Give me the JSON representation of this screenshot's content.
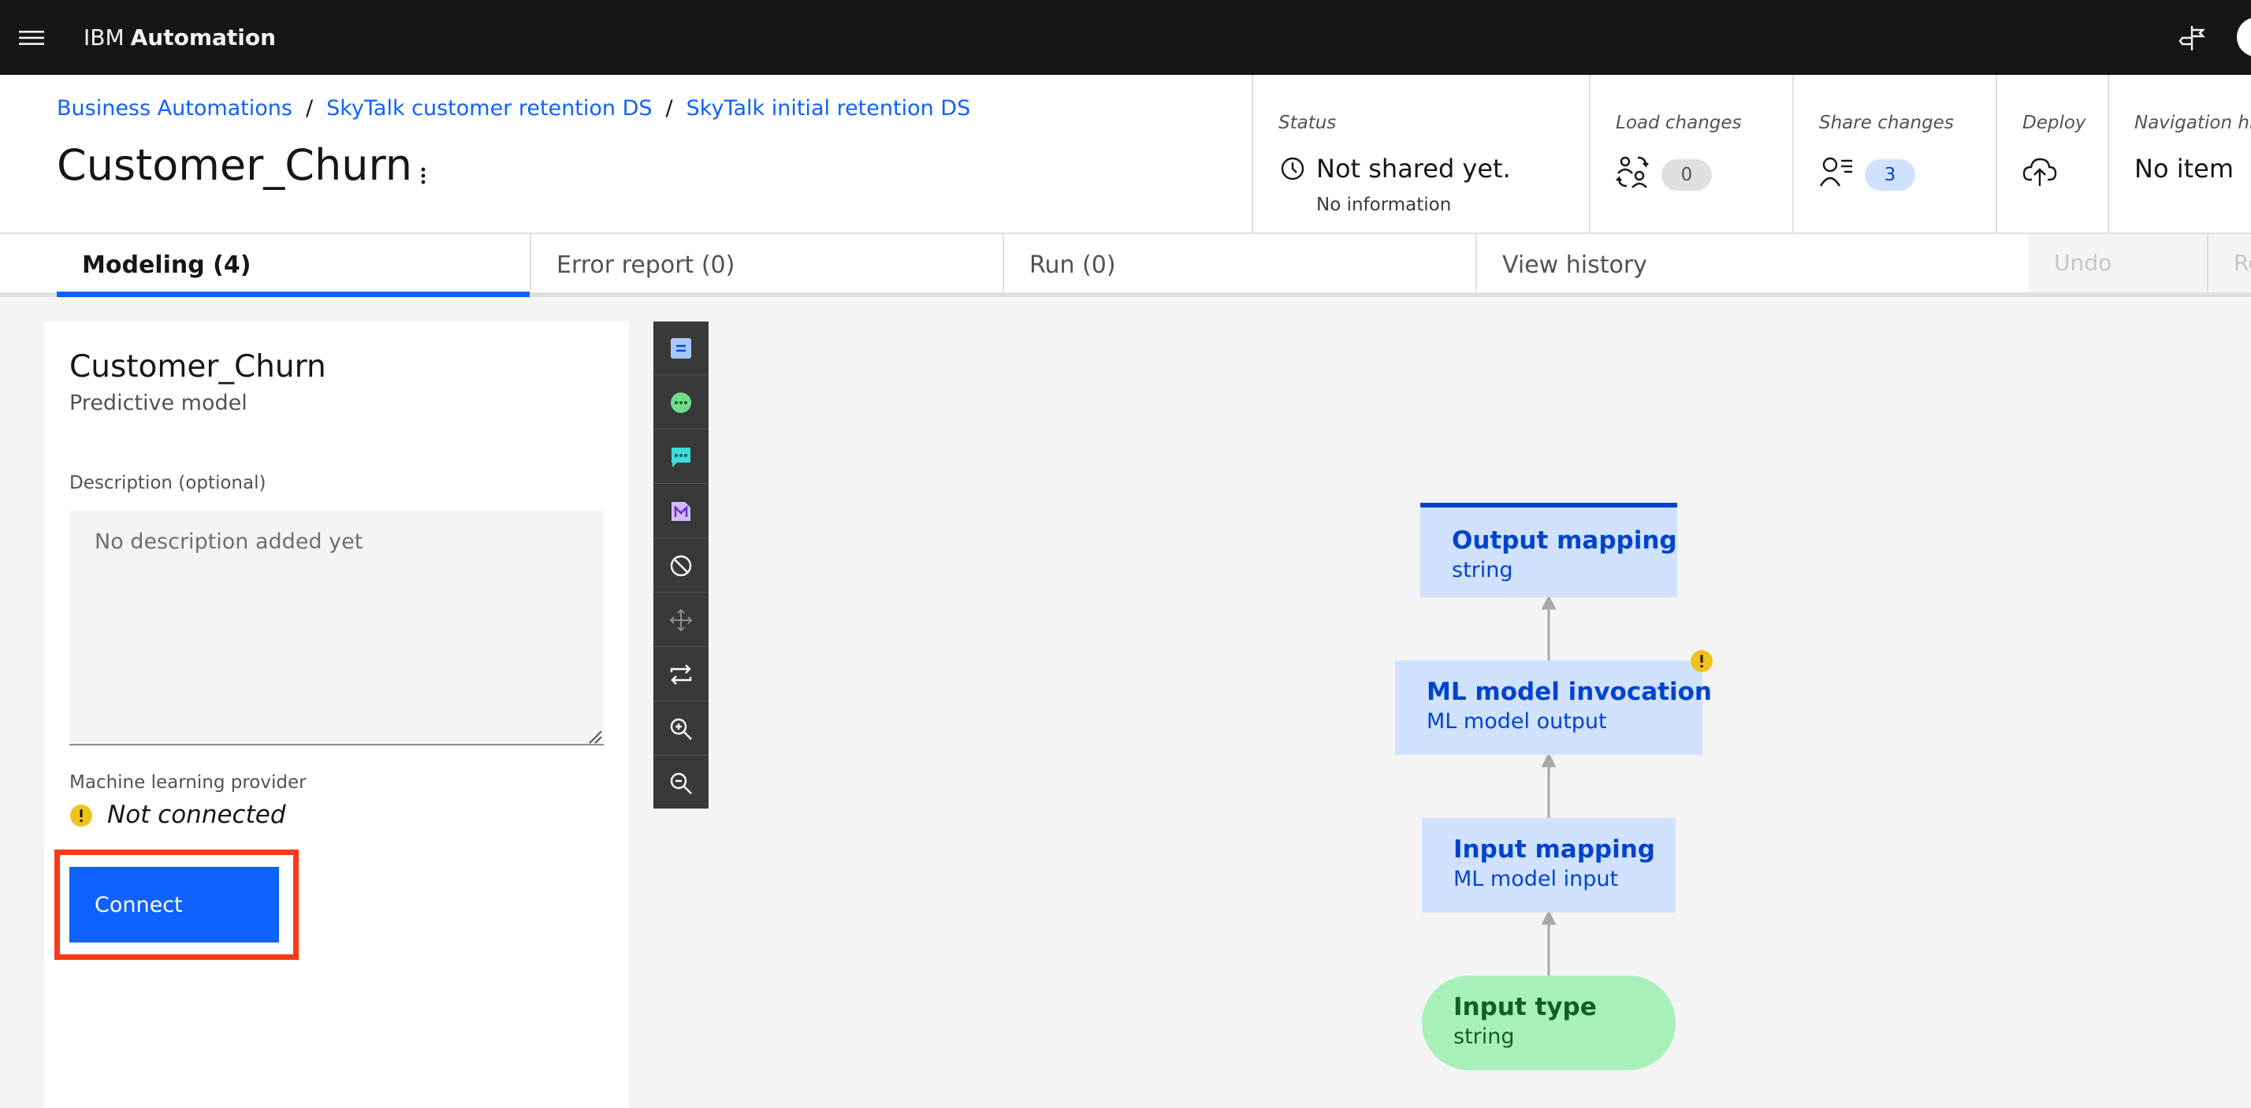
{
  "topbar": {
    "brand_prefix": "IBM",
    "brand_name": "Automation",
    "icons": [
      "menu-icon",
      "guide-icon"
    ]
  },
  "header": {
    "breadcrumb": [
      "Business Automations",
      "SkyTalk customer retention DS",
      "SkyTalk initial retention DS"
    ],
    "breadcrumb_separator": "/",
    "title": "Customer_Churn",
    "status": {
      "label": "Status",
      "value": "Not shared yet.",
      "sub": "No information"
    },
    "load_changes": {
      "label": "Load changes",
      "count": "0"
    },
    "share_changes": {
      "label": "Share changes",
      "count": "3"
    },
    "deploy": {
      "label": "Deploy"
    },
    "navigation_history": {
      "label": "Navigation hi",
      "value": "No item"
    }
  },
  "tabs": [
    {
      "label": "Modeling (4)",
      "active": true
    },
    {
      "label": "Error report (0)",
      "active": false
    },
    {
      "label": "Run (0)",
      "active": false
    },
    {
      "label": "View history",
      "active": false
    }
  ],
  "toolbar": {
    "undo_label": "Undo",
    "redo_label": "Re"
  },
  "panel": {
    "title": "Customer_Churn",
    "subtitle": "Predictive model",
    "description_label": "Description (optional)",
    "description_placeholder": "No description added yet",
    "description_value": "",
    "ml_provider_label": "Machine learning provider",
    "ml_provider_status": "Not connected",
    "connect_label": "Connect"
  },
  "vertical_toolbar": {
    "items": [
      "decision-node-icon",
      "function-node-icon",
      "comment-icon",
      "model-node-icon",
      "prohibit-icon",
      "move-icon",
      "swap-icon",
      "zoom-in-icon",
      "zoom-out-icon"
    ]
  },
  "diagram": {
    "nodes": [
      {
        "title": "Output mapping",
        "sub": "string"
      },
      {
        "title": "ML model invocation",
        "sub": "ML model output",
        "warning": true
      },
      {
        "title": "Input mapping",
        "sub": "ML model input"
      },
      {
        "title": "Input type",
        "sub": "string"
      }
    ]
  },
  "colors": {
    "primary": "#0f62fe",
    "highlight": "#fa3a1a",
    "warning": "#f1c21b",
    "node_blue": "#d0e2ff",
    "node_green": "#a7f0ba"
  }
}
